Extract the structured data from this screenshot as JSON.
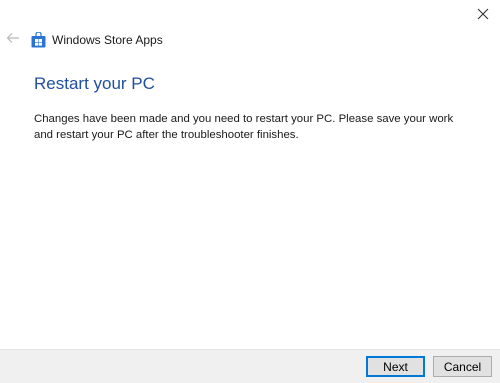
{
  "window": {
    "close_icon": "close-icon"
  },
  "header": {
    "back_icon": "back-arrow-icon",
    "app_icon": "windows-store-icon",
    "app_title": "Windows Store Apps"
  },
  "content": {
    "heading": "Restart your PC",
    "description": "Changes have been made and you need to restart your PC. Please save your work and restart your PC after the troubleshooter finishes."
  },
  "footer": {
    "next_label": "Next",
    "cancel_label": "Cancel"
  },
  "colors": {
    "heading": "#1f4f9e",
    "accent": "#0078d7",
    "footer_bg": "#f0f0f0",
    "store_icon": "#2b74d4"
  }
}
